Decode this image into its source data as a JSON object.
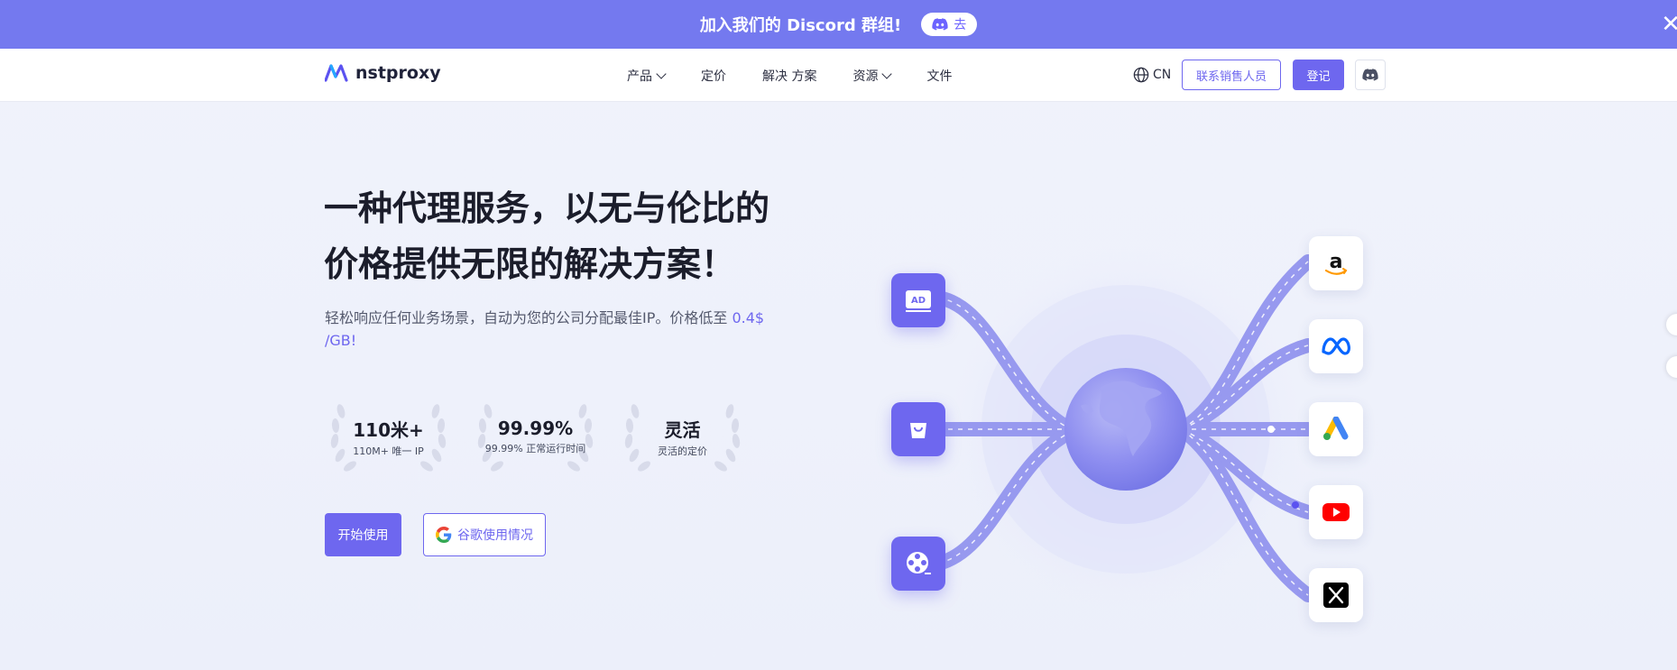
{
  "announcement": {
    "text": "加入我们的 Discord 群组!",
    "button_label": "去"
  },
  "nav": {
    "brand": "nstproxy",
    "menu": [
      {
        "label": "产品",
        "has_dropdown": true
      },
      {
        "label": "定价",
        "has_dropdown": false
      },
      {
        "label": "解决 方案",
        "has_dropdown": false
      },
      {
        "label": "资源",
        "has_dropdown": true
      },
      {
        "label": "文件",
        "has_dropdown": false
      }
    ],
    "language": "CN",
    "contact_sales": "联系销售人员",
    "login": "登记"
  },
  "hero": {
    "title_line1": "一种代理服务，以无与伦比的",
    "title_line2": "价格提供无限的解决方案！",
    "subtitle": "轻松响应任何业务场景，自动为您的公司分配最佳IP。价格低至 ",
    "price": "0.4$ /GB!",
    "stats": [
      {
        "value": "110米+",
        "label": "110M+ 唯一 IP"
      },
      {
        "value": "99.99%",
        "label": "99.99% 正常运行时间"
      },
      {
        "value": "灵活",
        "label": "灵活的定价"
      }
    ],
    "start_button": "开始使用",
    "google_button": "谷歌使用情况"
  },
  "illustration": {
    "left_icons": [
      "ad-icon",
      "shopping-bag-icon",
      "film-reel-icon"
    ],
    "left_ad_text": "AD",
    "right_icons": [
      "amazon-icon",
      "meta-icon",
      "google-ads-icon",
      "youtube-icon",
      "x-icon"
    ]
  },
  "colors": {
    "accent": "#6e67ef",
    "banner": "#7479ef"
  }
}
